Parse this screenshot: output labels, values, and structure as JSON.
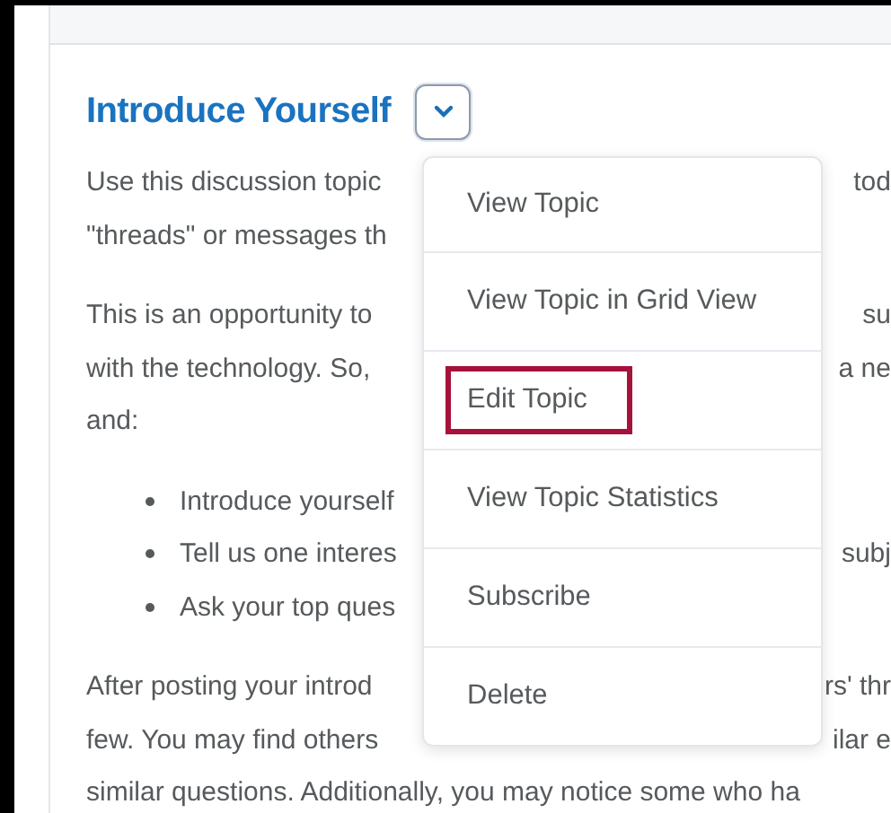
{
  "topic": {
    "title": "Introduce Yourself",
    "menu_open": true
  },
  "paragraphs": [
    {
      "kind": "text",
      "lines": [
        {
          "left": "Use this discussion topic",
          "right": "tod"
        },
        {
          "left": "\"threads\" or messages th"
        }
      ]
    },
    {
      "kind": "text",
      "lines": [
        {
          "left": "This is an opportunity to",
          "right": "su"
        },
        {
          "left": "with the technology. So,",
          "right": "a ne"
        },
        {
          "left": "and:"
        }
      ]
    },
    {
      "kind": "bullets",
      "lines": [
        {
          "left": "Introduce yourself"
        },
        {
          "left": "Tell us one interes",
          "right": "subj"
        },
        {
          "left": "Ask your top ques"
        }
      ]
    },
    {
      "kind": "text",
      "lines": [
        {
          "left": "After posting your introd",
          "right": "rs' thr"
        },
        {
          "left": "few. You may find others",
          "right": "ilar e"
        },
        {
          "left": "similar questions. Additionally, you may notice some who ha"
        }
      ]
    }
  ],
  "menu": [
    {
      "label": "View Topic",
      "highlighted": false
    },
    {
      "label": "View Topic in Grid View",
      "highlighted": false
    },
    {
      "label": "Edit Topic",
      "highlighted": true
    },
    {
      "label": "View Topic Statistics",
      "highlighted": false
    },
    {
      "label": "Subscribe",
      "highlighted": false
    },
    {
      "label": "Delete",
      "highlighted": false
    }
  ]
}
